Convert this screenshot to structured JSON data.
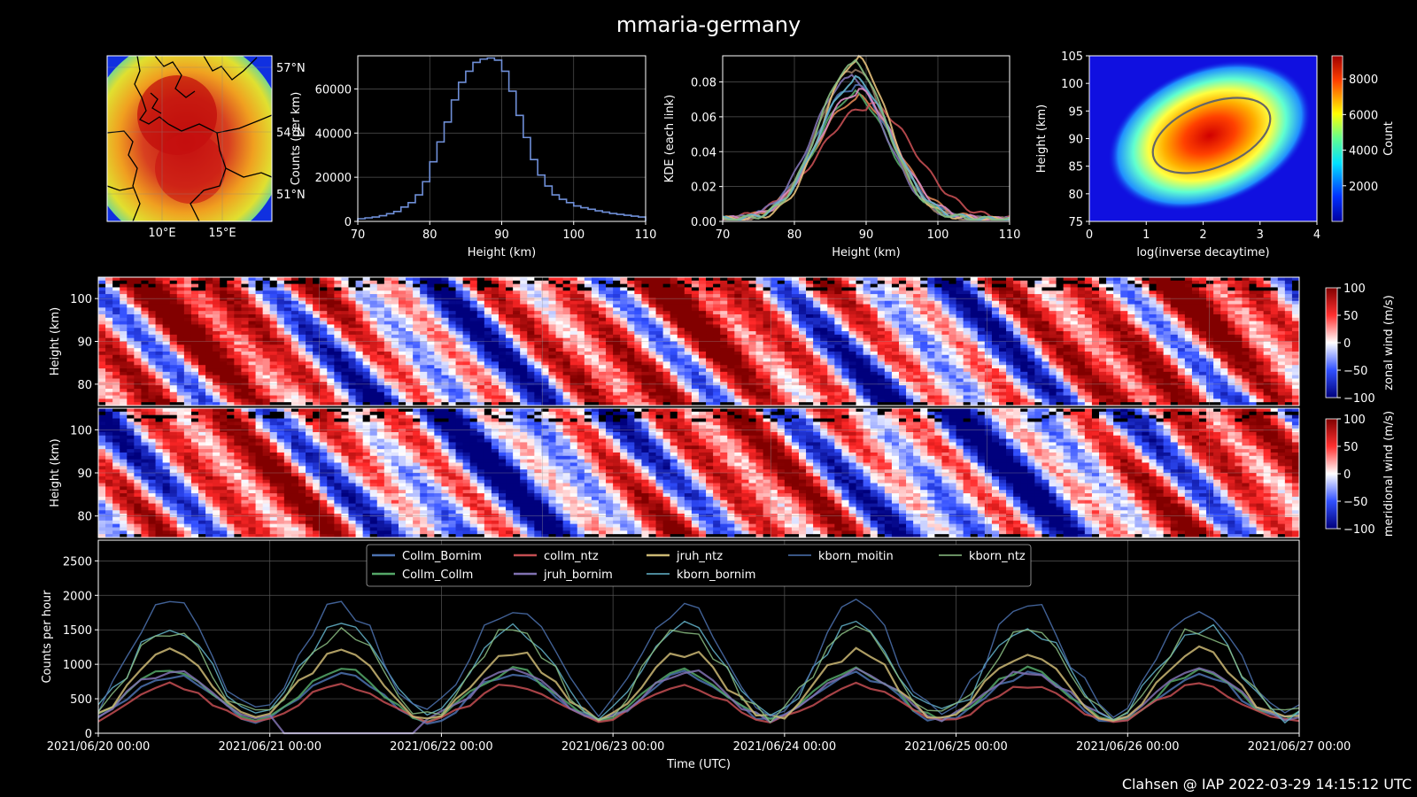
{
  "title": "mmaria-germany",
  "footer": "Clahsen @ IAP 2022-03-29 14:15:12 UTC",
  "map": {
    "lon_ticks": [
      "10°E",
      "15°E"
    ],
    "lat_ticks": [
      "57°N",
      "54°N",
      "51°N"
    ]
  },
  "chart_data": [
    {
      "type": "bar",
      "xlabel": "Height (km)",
      "ylabel": "Counts (per km)",
      "xlim": [
        70,
        110
      ],
      "ylim": [
        0,
        75000
      ],
      "xticks": [
        70,
        80,
        90,
        100,
        110
      ],
      "yticks": [
        0,
        20000,
        40000,
        60000
      ],
      "bin_width": 1,
      "x": [
        70,
        71,
        72,
        73,
        74,
        75,
        76,
        77,
        78,
        79,
        80,
        81,
        82,
        83,
        84,
        85,
        86,
        87,
        88,
        89,
        90,
        91,
        92,
        93,
        94,
        95,
        96,
        97,
        98,
        99,
        100,
        101,
        102,
        103,
        104,
        105,
        106,
        107,
        108,
        109
      ],
      "values": [
        1200,
        1600,
        2000,
        2600,
        3500,
        4500,
        6500,
        8500,
        12000,
        18000,
        27000,
        36000,
        45000,
        55000,
        63000,
        68000,
        72000,
        73500,
        74000,
        73000,
        68000,
        59000,
        48000,
        38000,
        28000,
        21000,
        16000,
        12000,
        10000,
        8500,
        7000,
        6200,
        5500,
        4800,
        4200,
        3600,
        3200,
        2800,
        2400,
        2000
      ],
      "color": "#6f8fd8"
    },
    {
      "type": "line",
      "xlabel": "Height (km)",
      "ylabel": "KDE (each link)",
      "xlim": [
        70,
        110
      ],
      "ylim": [
        0,
        0.095
      ],
      "xticks": [
        70,
        80,
        90,
        100,
        110
      ],
      "yticks": [
        0.0,
        0.02,
        0.04,
        0.06,
        0.08
      ],
      "series": [
        {
          "color": "#4c72b0",
          "peak": 0.075,
          "center": 88,
          "width": 5.2
        },
        {
          "color": "#dd8452",
          "peak": 0.068,
          "center": 88.5,
          "width": 5.5
        },
        {
          "color": "#55a868",
          "peak": 0.07,
          "center": 88,
          "width": 5.0
        },
        {
          "color": "#c44e52",
          "peak": 0.064,
          "center": 90,
          "width": 6.5
        },
        {
          "color": "#8172b2",
          "peak": 0.08,
          "center": 87.5,
          "width": 5.0
        },
        {
          "color": "#937860",
          "peak": 0.085,
          "center": 88,
          "width": 4.8
        },
        {
          "color": "#da8bc3",
          "peak": 0.072,
          "center": 88.5,
          "width": 5.3
        },
        {
          "color": "#e5c07b",
          "peak": 0.09,
          "center": 88.5,
          "width": 4.6
        },
        {
          "color": "#64b5cd",
          "peak": 0.078,
          "center": 88.3,
          "width": 5.0
        },
        {
          "color": "#8cc084",
          "peak": 0.088,
          "center": 88,
          "width": 4.7
        }
      ]
    },
    {
      "type": "heatmap",
      "xlabel": "log(inverse decaytime)",
      "ylabel": "Height (km)",
      "xlim": [
        0,
        4
      ],
      "ylim": [
        75,
        105
      ],
      "xticks": [
        0,
        1,
        2,
        3,
        4
      ],
      "yticks": [
        75,
        80,
        85,
        90,
        95,
        100,
        105
      ],
      "colorbar_label": "Count",
      "colorbar_ticks": [
        2000,
        4000,
        6000,
        8000
      ],
      "colorbar_max": 9300,
      "peak": {
        "x": 2.1,
        "y": 89.5,
        "value": 9300
      }
    },
    {
      "type": "heatmap",
      "ylabel": "Height (km)",
      "yticks": [
        80,
        90,
        100
      ],
      "ylim": [
        75,
        105
      ],
      "colorbar_label": "zonal wind (m/s)",
      "colorbar_ticks": [
        -100,
        -50,
        0,
        50,
        100
      ]
    },
    {
      "type": "heatmap",
      "ylabel": "Height (km)",
      "yticks": [
        80,
        90,
        100
      ],
      "ylim": [
        75,
        105
      ],
      "colorbar_label": "meridional wind (m/s)",
      "colorbar_ticks": [
        -100,
        -50,
        0,
        50,
        100
      ]
    },
    {
      "type": "line",
      "xlabel": "Time (UTC)",
      "ylabel": "Counts per hour",
      "ylim": [
        0,
        2800
      ],
      "yticks": [
        0,
        500,
        1000,
        1500,
        2000,
        2500
      ],
      "xticks": [
        "2021/06/20 00:00",
        "2021/06/21 00:00",
        "2021/06/22 00:00",
        "2021/06/23 00:00",
        "2021/06/24 00:00",
        "2021/06/25 00:00",
        "2021/06/26 00:00",
        "2021/06/27 00:00"
      ],
      "series": [
        {
          "name": "Collm_Bornim",
          "color": "#4c72b0",
          "mean": 520,
          "amp": 330
        },
        {
          "name": "Collm_Collm",
          "color": "#55a868",
          "mean": 560,
          "amp": 350
        },
        {
          "name": "collm_ntz",
          "color": "#c44e52",
          "mean": 440,
          "amp": 260
        },
        {
          "name": "jruh_bornim",
          "color": "#8172b2",
          "mean": 560,
          "amp": 340
        },
        {
          "name": "jruh_ntz",
          "color": "#ccb974",
          "mean": 700,
          "amp": 480
        },
        {
          "name": "kborn_bornim",
          "color": "#64b5cd",
          "mean": 900,
          "amp": 650
        },
        {
          "name": "kborn_moitin",
          "color": "#4c72b0",
          "mean": 1080,
          "amp": 780
        },
        {
          "name": "kborn_ntz",
          "color": "#8cc084",
          "mean": 870,
          "amp": 620
        }
      ],
      "legend": "upper center"
    }
  ]
}
